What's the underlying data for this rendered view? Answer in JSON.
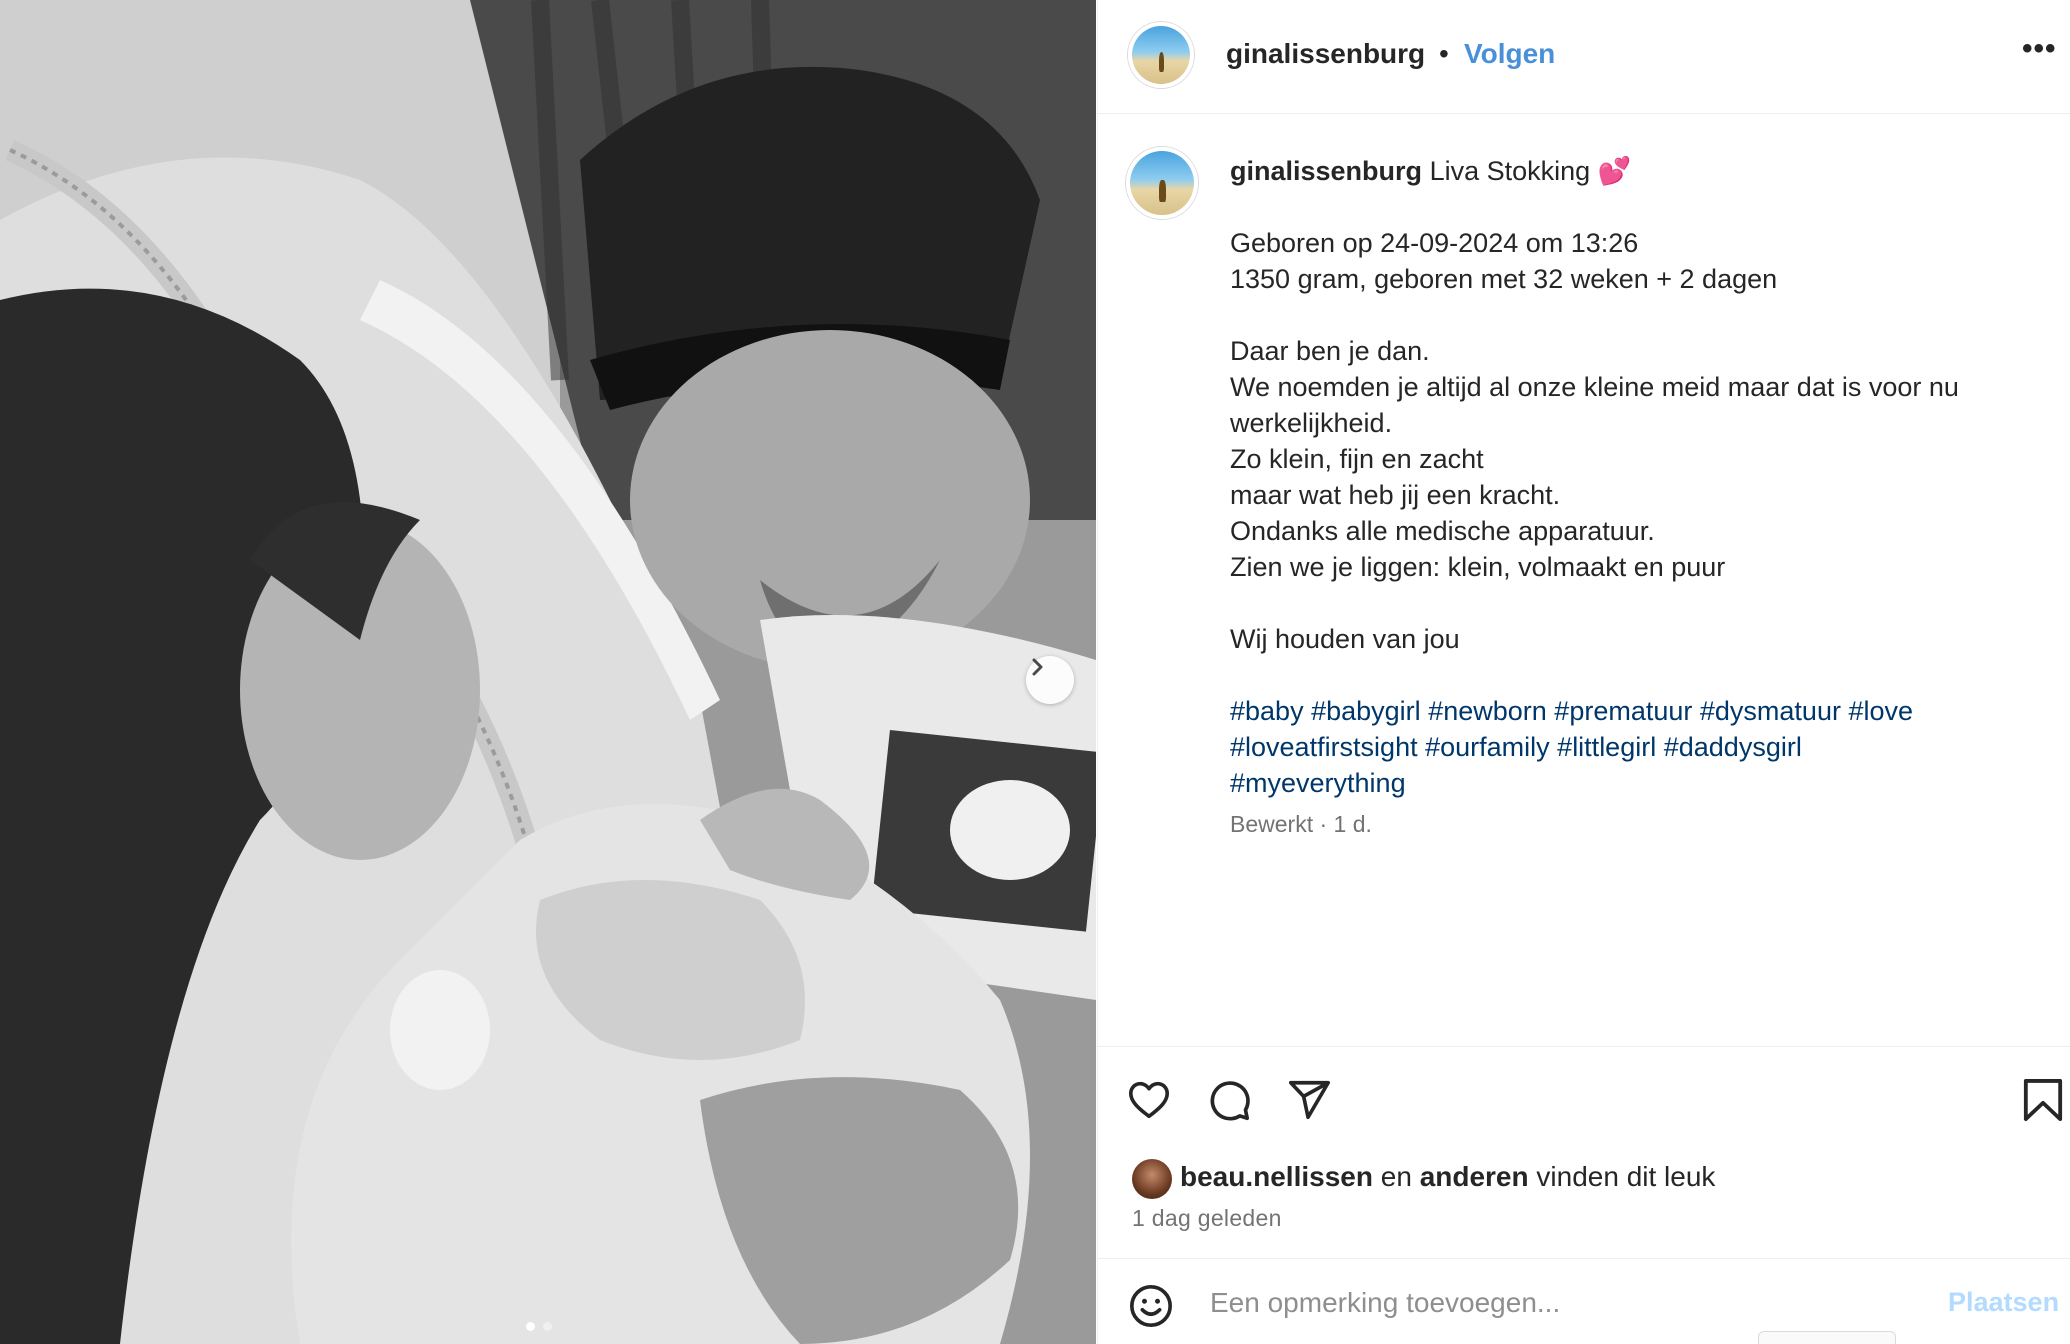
{
  "post": {
    "username": "ginalissenburg",
    "follow_label": "Volgen",
    "separator": "•",
    "more_label": "•••"
  },
  "caption": {
    "username": "ginalissenburg",
    "title": "Liva Stokking",
    "title_emoji": "💕",
    "lines": [
      "Geboren op 24-09-2024 om 13:26",
      "1350 gram, geboren met 32 weken + 2 dagen",
      "",
      "Daar ben je dan.",
      "We noemden je altijd al onze kleine meid maar dat is voor nu",
      "werkelijkheid.",
      "Zo klein, fijn en zacht",
      "maar wat heb jij een kracht.",
      "Ondanks alle medische apparatuur.",
      "Zien we je liggen: klein, volmaakt en puur",
      "",
      "Wij houden van jou"
    ],
    "hashtags_line1": [
      "#baby",
      "#babygirl",
      "#newborn",
      "#prematuur",
      "#dysmatuur",
      "#love"
    ],
    "hashtags_line2": [
      "#loveatfirstsight",
      "#ourfamily",
      "#littlegirl",
      "#daddysgirl"
    ],
    "hashtags_line3": [
      "#myeverything"
    ],
    "edited": "Bewerkt · 1 d."
  },
  "actions": {
    "like_icon": "heart-icon",
    "comment_icon": "comment-icon",
    "share_icon": "send-icon",
    "save_icon": "bookmark-icon"
  },
  "likes": {
    "user": "beau.nellissen",
    "connector": "en",
    "others": "anderen",
    "suffix": "vinden dit leuk"
  },
  "timestamp": "1 dag geleden",
  "comment": {
    "placeholder": "Een opmerking toevoegen...",
    "post_label": "Plaatsen",
    "emoji_icon": "smiley-icon"
  },
  "carousel": {
    "next_icon": "chevron-right-icon",
    "current_slide": 1,
    "total_slides": 2
  },
  "colors": {
    "link_blue": "#4a90d9",
    "hashtag_blue": "#00376b",
    "post_disabled": "#b3dbff",
    "muted_text": "#737373"
  }
}
